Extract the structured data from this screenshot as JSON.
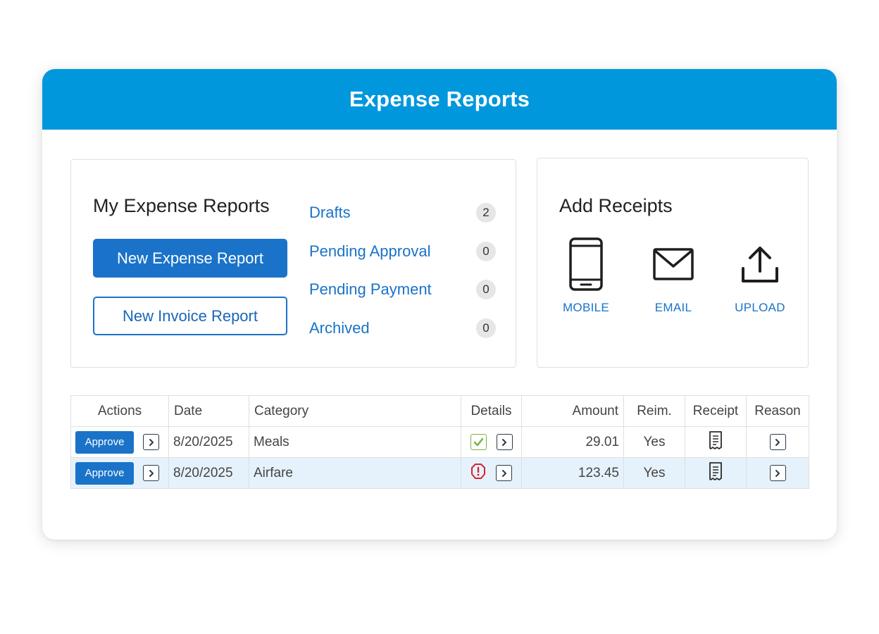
{
  "header": {
    "title": "Expense Reports"
  },
  "my_reports": {
    "heading": "My Expense Reports",
    "new_expense_label": "New Expense Report",
    "new_invoice_label": "New Invoice Report",
    "statuses": [
      {
        "label": "Drafts",
        "count": "2"
      },
      {
        "label": "Pending Approval",
        "count": "0"
      },
      {
        "label": "Pending Payment",
        "count": "0"
      },
      {
        "label": "Archived",
        "count": "0"
      }
    ]
  },
  "add_receipts": {
    "heading": "Add Receipts",
    "options": [
      {
        "label": "MOBILE",
        "icon": "mobile-phone-icon"
      },
      {
        "label": "EMAIL",
        "icon": "envelope-icon"
      },
      {
        "label": "UPLOAD",
        "icon": "upload-icon"
      }
    ]
  },
  "table": {
    "columns": [
      "Actions",
      "Date",
      "Category",
      "Details",
      "Amount",
      "Reim.",
      "Receipt",
      "Reason"
    ],
    "rows": [
      {
        "action_label": "Approve",
        "date": "8/20/2025",
        "category": "Meals",
        "details_status": "check-icon",
        "amount": "29.01",
        "reimbursable": "Yes",
        "receipt_icon": "receipt-icon"
      },
      {
        "action_label": "Approve",
        "date": "8/20/2025",
        "category": "Airfare",
        "details_status": "alert-shield-icon",
        "amount": "123.45",
        "reimbursable": "Yes",
        "receipt_icon": "receipt-icon"
      }
    ]
  },
  "colors": {
    "header_bg": "#0097dc",
    "primary": "#1a73c9",
    "row_highlight": "#e6f2fb",
    "ok_green": "#78b442",
    "alert_red": "#d9232d"
  }
}
